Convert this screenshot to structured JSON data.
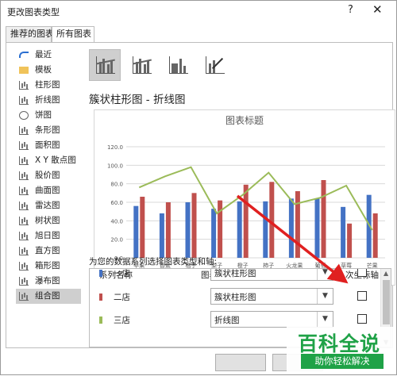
{
  "window": {
    "title": "更改图表类型",
    "help_label": "?",
    "close_label": "✕"
  },
  "tabs": [
    {
      "label": "推荐的图表",
      "active": false
    },
    {
      "label": "所有图表",
      "active": true
    }
  ],
  "categories": [
    {
      "label": "最近",
      "icon": "recent-icon",
      "selected": false
    },
    {
      "label": "模板",
      "icon": "folder-icon",
      "selected": false
    },
    {
      "label": "柱形图",
      "icon": "column-chart-icon",
      "selected": false
    },
    {
      "label": "折线图",
      "icon": "line-chart-icon",
      "selected": false
    },
    {
      "label": "饼图",
      "icon": "pie-chart-icon",
      "selected": false
    },
    {
      "label": "条形图",
      "icon": "bar-chart-icon",
      "selected": false
    },
    {
      "label": "面积图",
      "icon": "area-chart-icon",
      "selected": false
    },
    {
      "label": "X Y 散点图",
      "icon": "scatter-chart-icon",
      "selected": false
    },
    {
      "label": "股价图",
      "icon": "stock-chart-icon",
      "selected": false
    },
    {
      "label": "曲面图",
      "icon": "surface-chart-icon",
      "selected": false
    },
    {
      "label": "雷达图",
      "icon": "radar-chart-icon",
      "selected": false
    },
    {
      "label": "树状图",
      "icon": "treemap-chart-icon",
      "selected": false
    },
    {
      "label": "旭日图",
      "icon": "sunburst-chart-icon",
      "selected": false
    },
    {
      "label": "直方图",
      "icon": "histogram-chart-icon",
      "selected": false
    },
    {
      "label": "箱形图",
      "icon": "box-whisker-chart-icon",
      "selected": false
    },
    {
      "label": "瀑布图",
      "icon": "waterfall-chart-icon",
      "selected": false
    },
    {
      "label": "组合图",
      "icon": "combo-chart-icon",
      "selected": true
    }
  ],
  "subtypes": [
    {
      "icon": "clustered-column-line-icon",
      "selected": true
    },
    {
      "icon": "clustered-column-line-secondary-axis-icon",
      "selected": false
    },
    {
      "icon": "stacked-area-clustered-column-icon",
      "selected": false
    },
    {
      "icon": "custom-combination-icon",
      "selected": false
    }
  ],
  "main": {
    "chart_type_heading": "簇状柱形图 - 折线图",
    "series_prompt": "为您的数据系列选择图表类型和轴:",
    "table_headers": {
      "series_name": "系列名称",
      "chart_type": "图表类型",
      "secondary_axis": "次坐标轴"
    },
    "series_rows": [
      {
        "name": "一店",
        "color": "#4472c4",
        "chart_type": "簇状柱形图",
        "secondary_axis": false
      },
      {
        "name": "二店",
        "color": "#c0504d",
        "chart_type": "簇状柱形图",
        "secondary_axis": false
      },
      {
        "name": "三店",
        "color": "#9bbb59",
        "chart_type": "折线图",
        "secondary_axis": false
      }
    ]
  },
  "chart_data": {
    "type": "bar",
    "title": "图表标题",
    "categories": [
      "苹果",
      "香蕉",
      "桔子",
      "梨子",
      "橙子",
      "柿子",
      "火龙果",
      "葡萄",
      "草莓",
      "芒果"
    ],
    "series": [
      {
        "name": "一店",
        "type": "bar",
        "color": "#4472c4",
        "values": [
          56,
          48,
          60,
          53,
          61,
          61,
          64,
          64,
          55,
          68
        ]
      },
      {
        "name": "二店",
        "type": "bar",
        "color": "#c0504d",
        "values": [
          66,
          60,
          70,
          62,
          79,
          82,
          72,
          84,
          37,
          48
        ]
      },
      {
        "name": "三店",
        "type": "line",
        "color": "#9bbb59",
        "values": [
          76,
          88,
          98,
          48,
          68,
          92,
          58,
          65,
          78,
          30
        ]
      }
    ],
    "ylim": [
      0,
      120
    ],
    "yticks": [
      "0.0",
      "20.0",
      "40.0",
      "60.0",
      "80.0",
      "100.0",
      "120.0"
    ],
    "grid": true,
    "legend_position": "bottom"
  },
  "annotation": {
    "color": "#e02020"
  },
  "watermark": {
    "main": "百科全说",
    "sub": "助你轻松解决",
    "color": "#1fa247"
  }
}
